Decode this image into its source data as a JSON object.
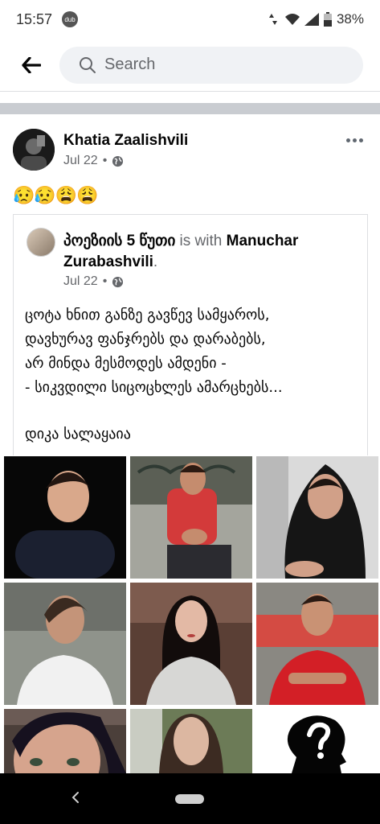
{
  "status_bar": {
    "time": "15:57",
    "badge": "dub",
    "battery": "38%"
  },
  "search": {
    "placeholder": "Search"
  },
  "post": {
    "author": "Khatia Zaalishvili",
    "date": "Jul 22",
    "separator": "•",
    "emoji": "😥😥😩😩"
  },
  "shared_post": {
    "page_name": "პოეზიის 5 წუთი",
    "with_text": " is with ",
    "tagged_name": "Manuchar Zurabashvili",
    "period": ".",
    "date": "Jul 22",
    "separator": "•",
    "poem_lines": [
      "ცოტა ხნით განზე გავწევ სამყაროს,",
      "დავხურავ ფანჯრებს და დარაბებს,",
      "არ მინდა მესმოდეს ამდენი -",
      "- სიკვდილი სიცოცხლეს ამარცხებს..."
    ],
    "signature": "დიკა სალაყაია"
  },
  "photo_grid": {
    "tile_labels": [
      "",
      "",
      "",
      "",
      "",
      "",
      "",
      "",
      ""
    ],
    "tile_colors": [
      "#0a0a0a",
      "#9a9a93",
      "#d8d8d8",
      "#8b8e88",
      "#5a3d33",
      "#b24b3c",
      "#4b3f3a",
      "#6d7c5a",
      "#ffffff"
    ]
  },
  "nav": {
    "back": "‹"
  }
}
